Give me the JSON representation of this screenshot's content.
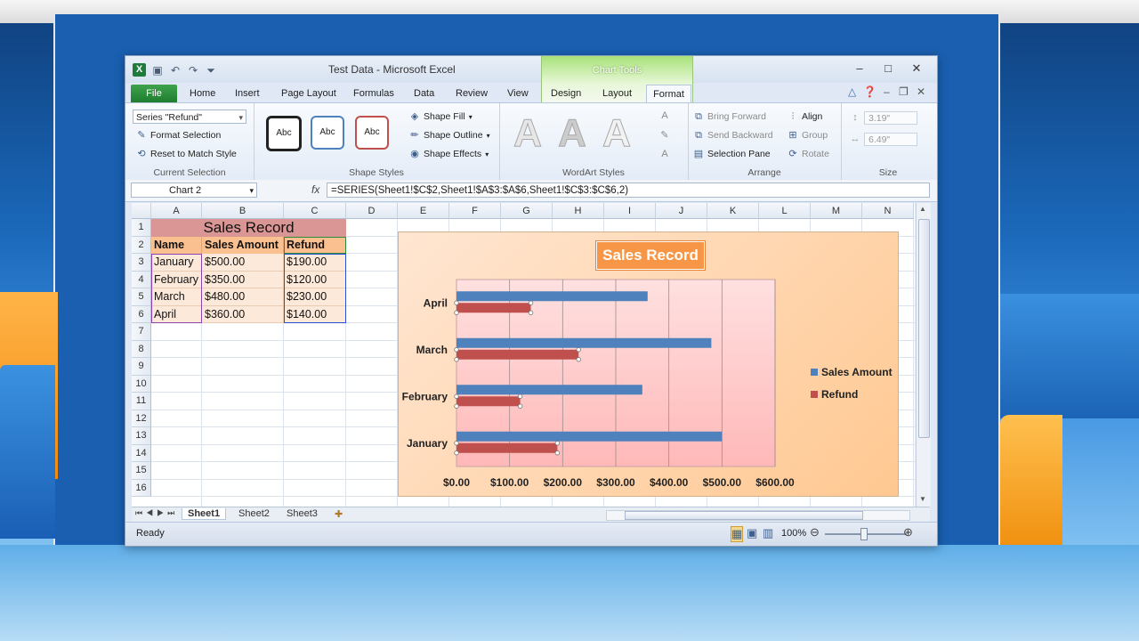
{
  "window": {
    "title": "Test Data  -  Microsoft Excel",
    "context_tab": "Chart Tools"
  },
  "tabs": [
    "File",
    "Home",
    "Insert",
    "Page Layout",
    "Formulas",
    "Data",
    "Review",
    "View",
    "Design",
    "Layout",
    "Format"
  ],
  "ribbon": {
    "current_selection": {
      "dropdown": "Series \"Refund\"",
      "format_selection": "Format Selection",
      "reset": "Reset to Match Style",
      "label": "Current Selection"
    },
    "shape_styles": {
      "samples": [
        "Abc",
        "Abc",
        "Abc"
      ],
      "fill": "Shape Fill",
      "outline": "Shape Outline",
      "effects": "Shape Effects",
      "label": "Shape Styles"
    },
    "wordart": {
      "letter": "A",
      "label": "WordArt Styles"
    },
    "arrange": {
      "bring_forward": "Bring Forward",
      "send_backward": "Send Backward",
      "selection_pane": "Selection Pane",
      "align": "Align",
      "group": "Group",
      "rotate": "Rotate",
      "label": "Arrange"
    },
    "size": {
      "height": "3.19\"",
      "width": "6.49\"",
      "label": "Size"
    }
  },
  "formula_bar": {
    "name_box": "Chart 2",
    "fx": "fx",
    "formula": "=SERIES(Sheet1!$C$2,Sheet1!$A$3:$A$6,Sheet1!$C$3:$C$6,2)"
  },
  "columns": [
    "A",
    "B",
    "C",
    "D",
    "E",
    "F",
    "G",
    "H",
    "I",
    "J",
    "K",
    "L",
    "M",
    "N"
  ],
  "rows": [
    "1",
    "2",
    "3",
    "4",
    "5",
    "6",
    "7",
    "8",
    "9",
    "10",
    "11",
    "12",
    "13",
    "14",
    "15",
    "16"
  ],
  "sheet": {
    "title": "Sales Record",
    "headers": [
      "Name",
      "Sales Amount",
      "Refund"
    ],
    "data": [
      [
        "January",
        "$500.00",
        "$190.00"
      ],
      [
        "February",
        "$350.00",
        "$120.00"
      ],
      [
        "March",
        "$480.00",
        "$230.00"
      ],
      [
        "April",
        "$360.00",
        "$140.00"
      ]
    ]
  },
  "sheet_tabs": [
    "Sheet1",
    "Sheet2",
    "Sheet3"
  ],
  "status": {
    "ready": "Ready",
    "zoom": "100%"
  },
  "chart_data": {
    "type": "bar",
    "orientation": "horizontal",
    "title": "Sales Record",
    "categories": [
      "January",
      "February",
      "March",
      "April"
    ],
    "series": [
      {
        "name": "Sales Amount",
        "values": [
          500,
          350,
          480,
          360
        ],
        "color": "#4f81bd"
      },
      {
        "name": "Refund",
        "values": [
          190,
          120,
          230,
          140
        ],
        "color": "#c0504d"
      }
    ],
    "xlim": [
      0,
      600
    ],
    "tick_labels": [
      "$0.00",
      "$100.00",
      "$200.00",
      "$300.00",
      "$400.00",
      "$500.00",
      "$600.00"
    ],
    "grid": true,
    "legend": "right"
  }
}
